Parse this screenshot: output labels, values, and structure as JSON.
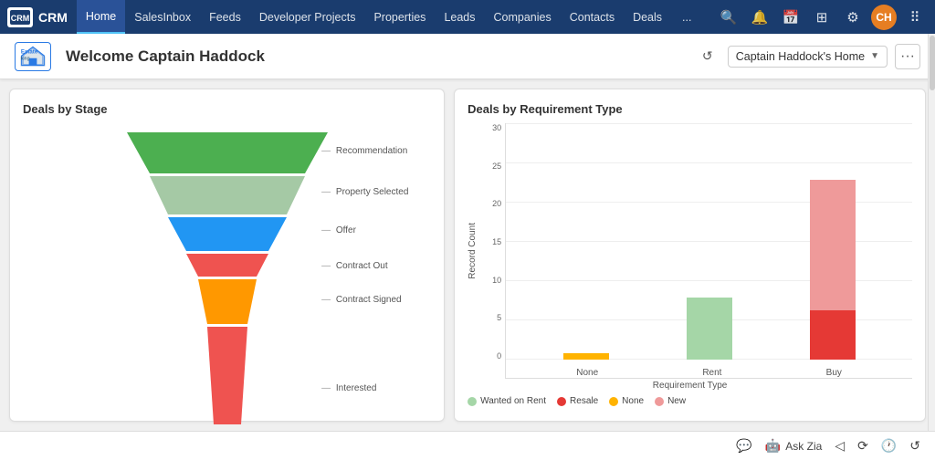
{
  "nav": {
    "logo_text": "CRM",
    "items": [
      {
        "label": "Home",
        "active": true
      },
      {
        "label": "SalesInbox",
        "active": false
      },
      {
        "label": "Feeds",
        "active": false
      },
      {
        "label": "Developer Projects",
        "active": false
      },
      {
        "label": "Properties",
        "active": false
      },
      {
        "label": "Leads",
        "active": false
      },
      {
        "label": "Companies",
        "active": false
      },
      {
        "label": "Contacts",
        "active": false
      },
      {
        "label": "Deals",
        "active": false
      },
      {
        "label": "...",
        "active": false
      }
    ]
  },
  "header": {
    "welcome_text": "Welcome Captain Haddock",
    "home_label": "Captain Haddock's Home",
    "company_name": "Estateking"
  },
  "deals_by_stage": {
    "title": "Deals by Stage",
    "stages": [
      {
        "label": "Recommendation",
        "color": "#4caf50"
      },
      {
        "label": "Property Selected",
        "color": "#a5c9a5"
      },
      {
        "label": "Offer",
        "color": "#2196f3"
      },
      {
        "label": "Contract Out",
        "color": "#ef5350"
      },
      {
        "label": "Contract Signed",
        "color": "#ff9800"
      },
      {
        "label": "Interested",
        "color": "#ef5350"
      }
    ]
  },
  "deals_by_req": {
    "title": "Deals by Requirement Type",
    "y_axis_title": "Record Count",
    "x_axis_title": "Requirement Type",
    "y_labels": [
      "0",
      "5",
      "10",
      "15",
      "20",
      "25",
      "30"
    ],
    "bars": [
      {
        "label": "None",
        "segments": [
          {
            "color": "#ffb300",
            "value": 1,
            "series": "None"
          }
        ]
      },
      {
        "label": "Rent",
        "segments": [
          {
            "color": "#a5d6a7",
            "value": 9.5,
            "series": "Wanted on Rent"
          }
        ]
      },
      {
        "label": "Buy",
        "segments": [
          {
            "color": "#e53935",
            "value": 7.5,
            "series": "Resale"
          },
          {
            "color": "#ef9a9a",
            "value": 20,
            "series": "New"
          }
        ]
      }
    ],
    "legend": [
      {
        "label": "Wanted on Rent",
        "color": "#a5d6a7"
      },
      {
        "label": "Resale",
        "color": "#e53935"
      },
      {
        "label": "None",
        "color": "#ffb300"
      },
      {
        "label": "New",
        "color": "#ef9a9a"
      }
    ]
  },
  "footer": {
    "ask_zia": "Ask Zia",
    "icons": [
      "chat-icon",
      "zia-icon",
      "back-icon",
      "reload-icon",
      "clock-icon",
      "refresh2-icon"
    ]
  }
}
